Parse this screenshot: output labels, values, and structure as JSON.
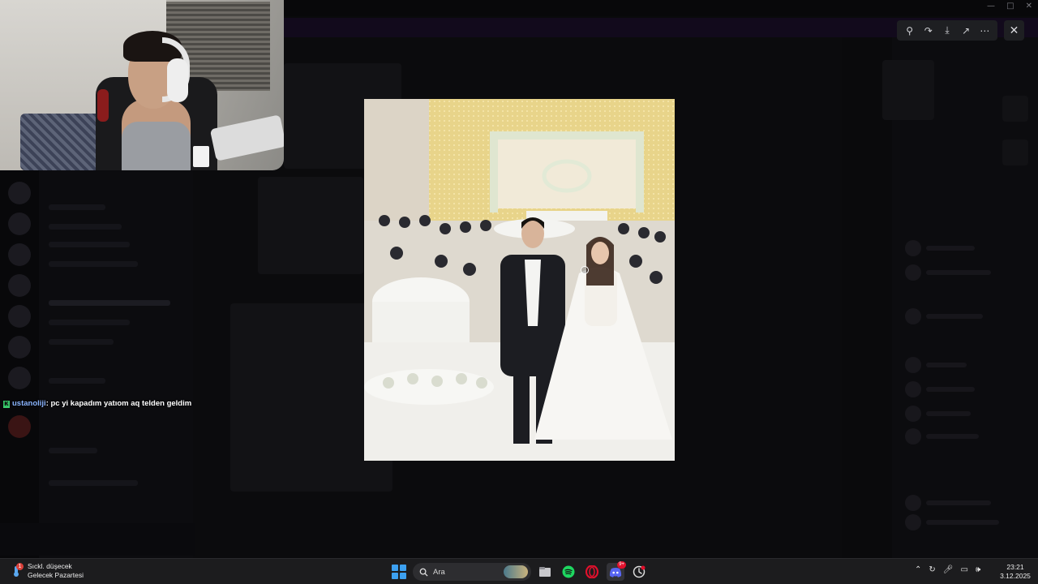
{
  "chat": {
    "username": "ustanoliji",
    "message": ": pc yi kapadım yatıom aq telden geldim",
    "badge": "K"
  },
  "viewer": {
    "tools": [
      "zoom-icon",
      "forward-icon",
      "download-icon",
      "open-external-icon",
      "more-icon"
    ],
    "close_icon": "close-icon"
  },
  "taskbar": {
    "weather_line1": "Sıckl. düşecek",
    "weather_line2": "Gelecek Pazartesi",
    "weather_badge": "1",
    "search_label": "Ara",
    "discord_badge": "9+",
    "time": "23:21",
    "date": "3.12.2025",
    "apps": [
      "start-icon",
      "file-explorer-icon",
      "spotify-icon",
      "opera-icon",
      "discord-icon",
      "misc-app-icon"
    ]
  },
  "colors": {
    "accent_blue": "#3ca0f0",
    "spotify_green": "#1ed760",
    "opera_red": "#e1102c",
    "discord_blurple": "#5865f2",
    "chat_badge_green": "#3bd16f"
  }
}
